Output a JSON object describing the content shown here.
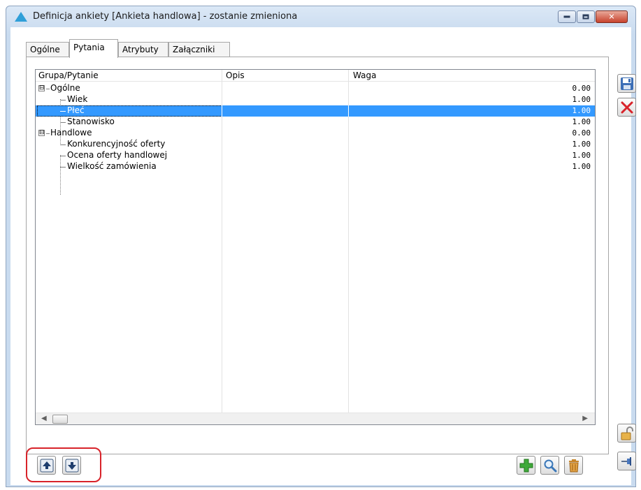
{
  "window": {
    "title": "Definicja ankiety [Ankieta handlowa] - zostanie zmieniona"
  },
  "tabs": [
    {
      "label": "Ogólne"
    },
    {
      "label": "Pytania"
    },
    {
      "label": "Atrybuty"
    },
    {
      "label": "Załączniki"
    }
  ],
  "active_tab": "Pytania",
  "grid": {
    "columns": [
      "Grupa/Pytanie",
      "Opis",
      "Waga"
    ],
    "rows": [
      {
        "name": "Ogólne",
        "opis": "",
        "waga": "0.00",
        "expander": "⊟"
      },
      {
        "name": "Wiek",
        "opis": "",
        "waga": "1.00"
      },
      {
        "name": "Płeć",
        "opis": "",
        "waga": "1.00",
        "selected": true
      },
      {
        "name": "Stanowisko",
        "opis": "",
        "waga": "1.00"
      },
      {
        "name": "Handlowe",
        "opis": "",
        "waga": "0.00",
        "expander": "⊟"
      },
      {
        "name": "Konkurencyjność oferty",
        "opis": "",
        "waga": "1.00"
      },
      {
        "name": "Ocena oferty handlowej",
        "opis": "",
        "waga": "1.00"
      },
      {
        "name": "Wielkość zamówienia",
        "opis": "",
        "waga": "1.00"
      }
    ]
  },
  "icons": {
    "save": "save-icon",
    "cancel": "close-icon",
    "lock": "lock-icon",
    "pin": "pin-icon",
    "move_up": "move-up-icon",
    "move_down": "move-down-icon",
    "add": "add-icon",
    "preview": "magnifier-icon",
    "delete": "trash-icon"
  },
  "colors": {
    "selection": "#3399ff",
    "highlight_frame": "#d8232a",
    "add_green": "#3fa93a",
    "delete_orange": "#c8852a"
  }
}
